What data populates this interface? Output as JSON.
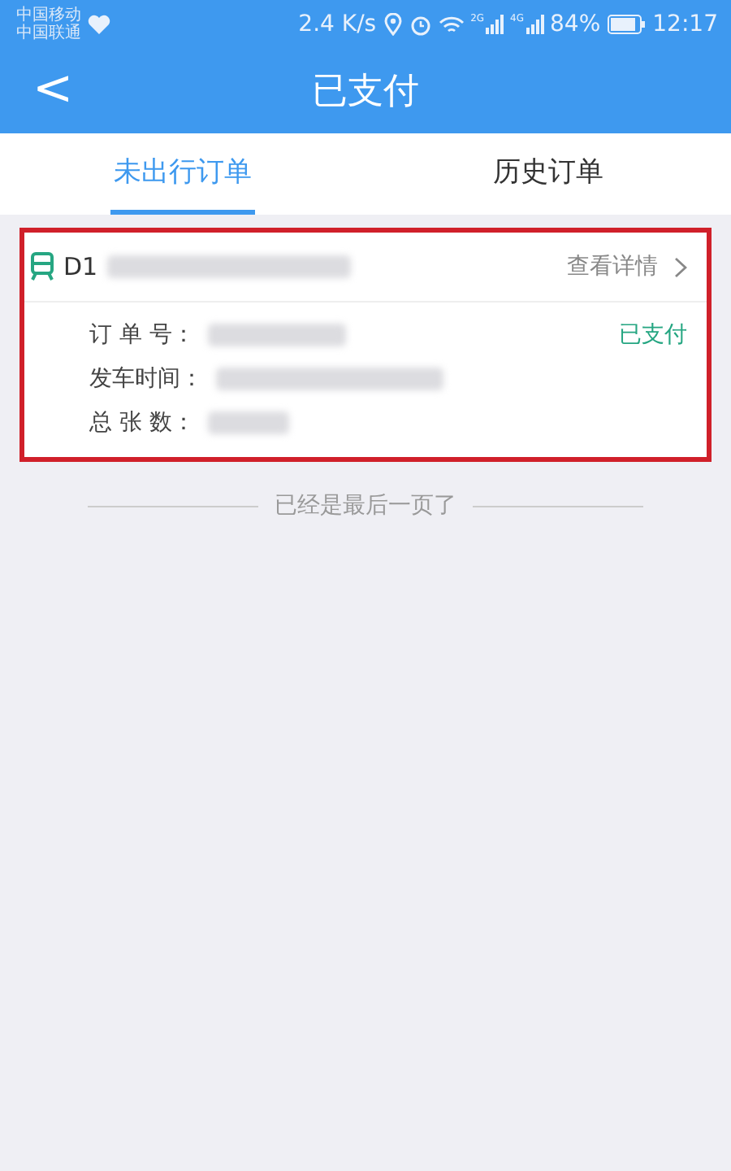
{
  "status_bar": {
    "carriers": [
      "中国移动",
      "中国联通"
    ],
    "speed": "2.4 K/s",
    "network_1": "2G",
    "network_2": "4G",
    "battery": "84%",
    "time": "12:17"
  },
  "header": {
    "back": "<",
    "title": "已支付"
  },
  "tabs": [
    {
      "label": "未出行订单",
      "selected": true
    },
    {
      "label": "历史订单",
      "selected": false
    }
  ],
  "orders": [
    {
      "train": "D1",
      "detail_link": "查看详情",
      "status": "已支付",
      "fields": [
        {
          "label": "订 单 号："
        },
        {
          "label": "发车时间："
        },
        {
          "label": "总 张 数："
        }
      ],
      "highlighted": true
    }
  ],
  "end_note": "已经是最后一页了"
}
